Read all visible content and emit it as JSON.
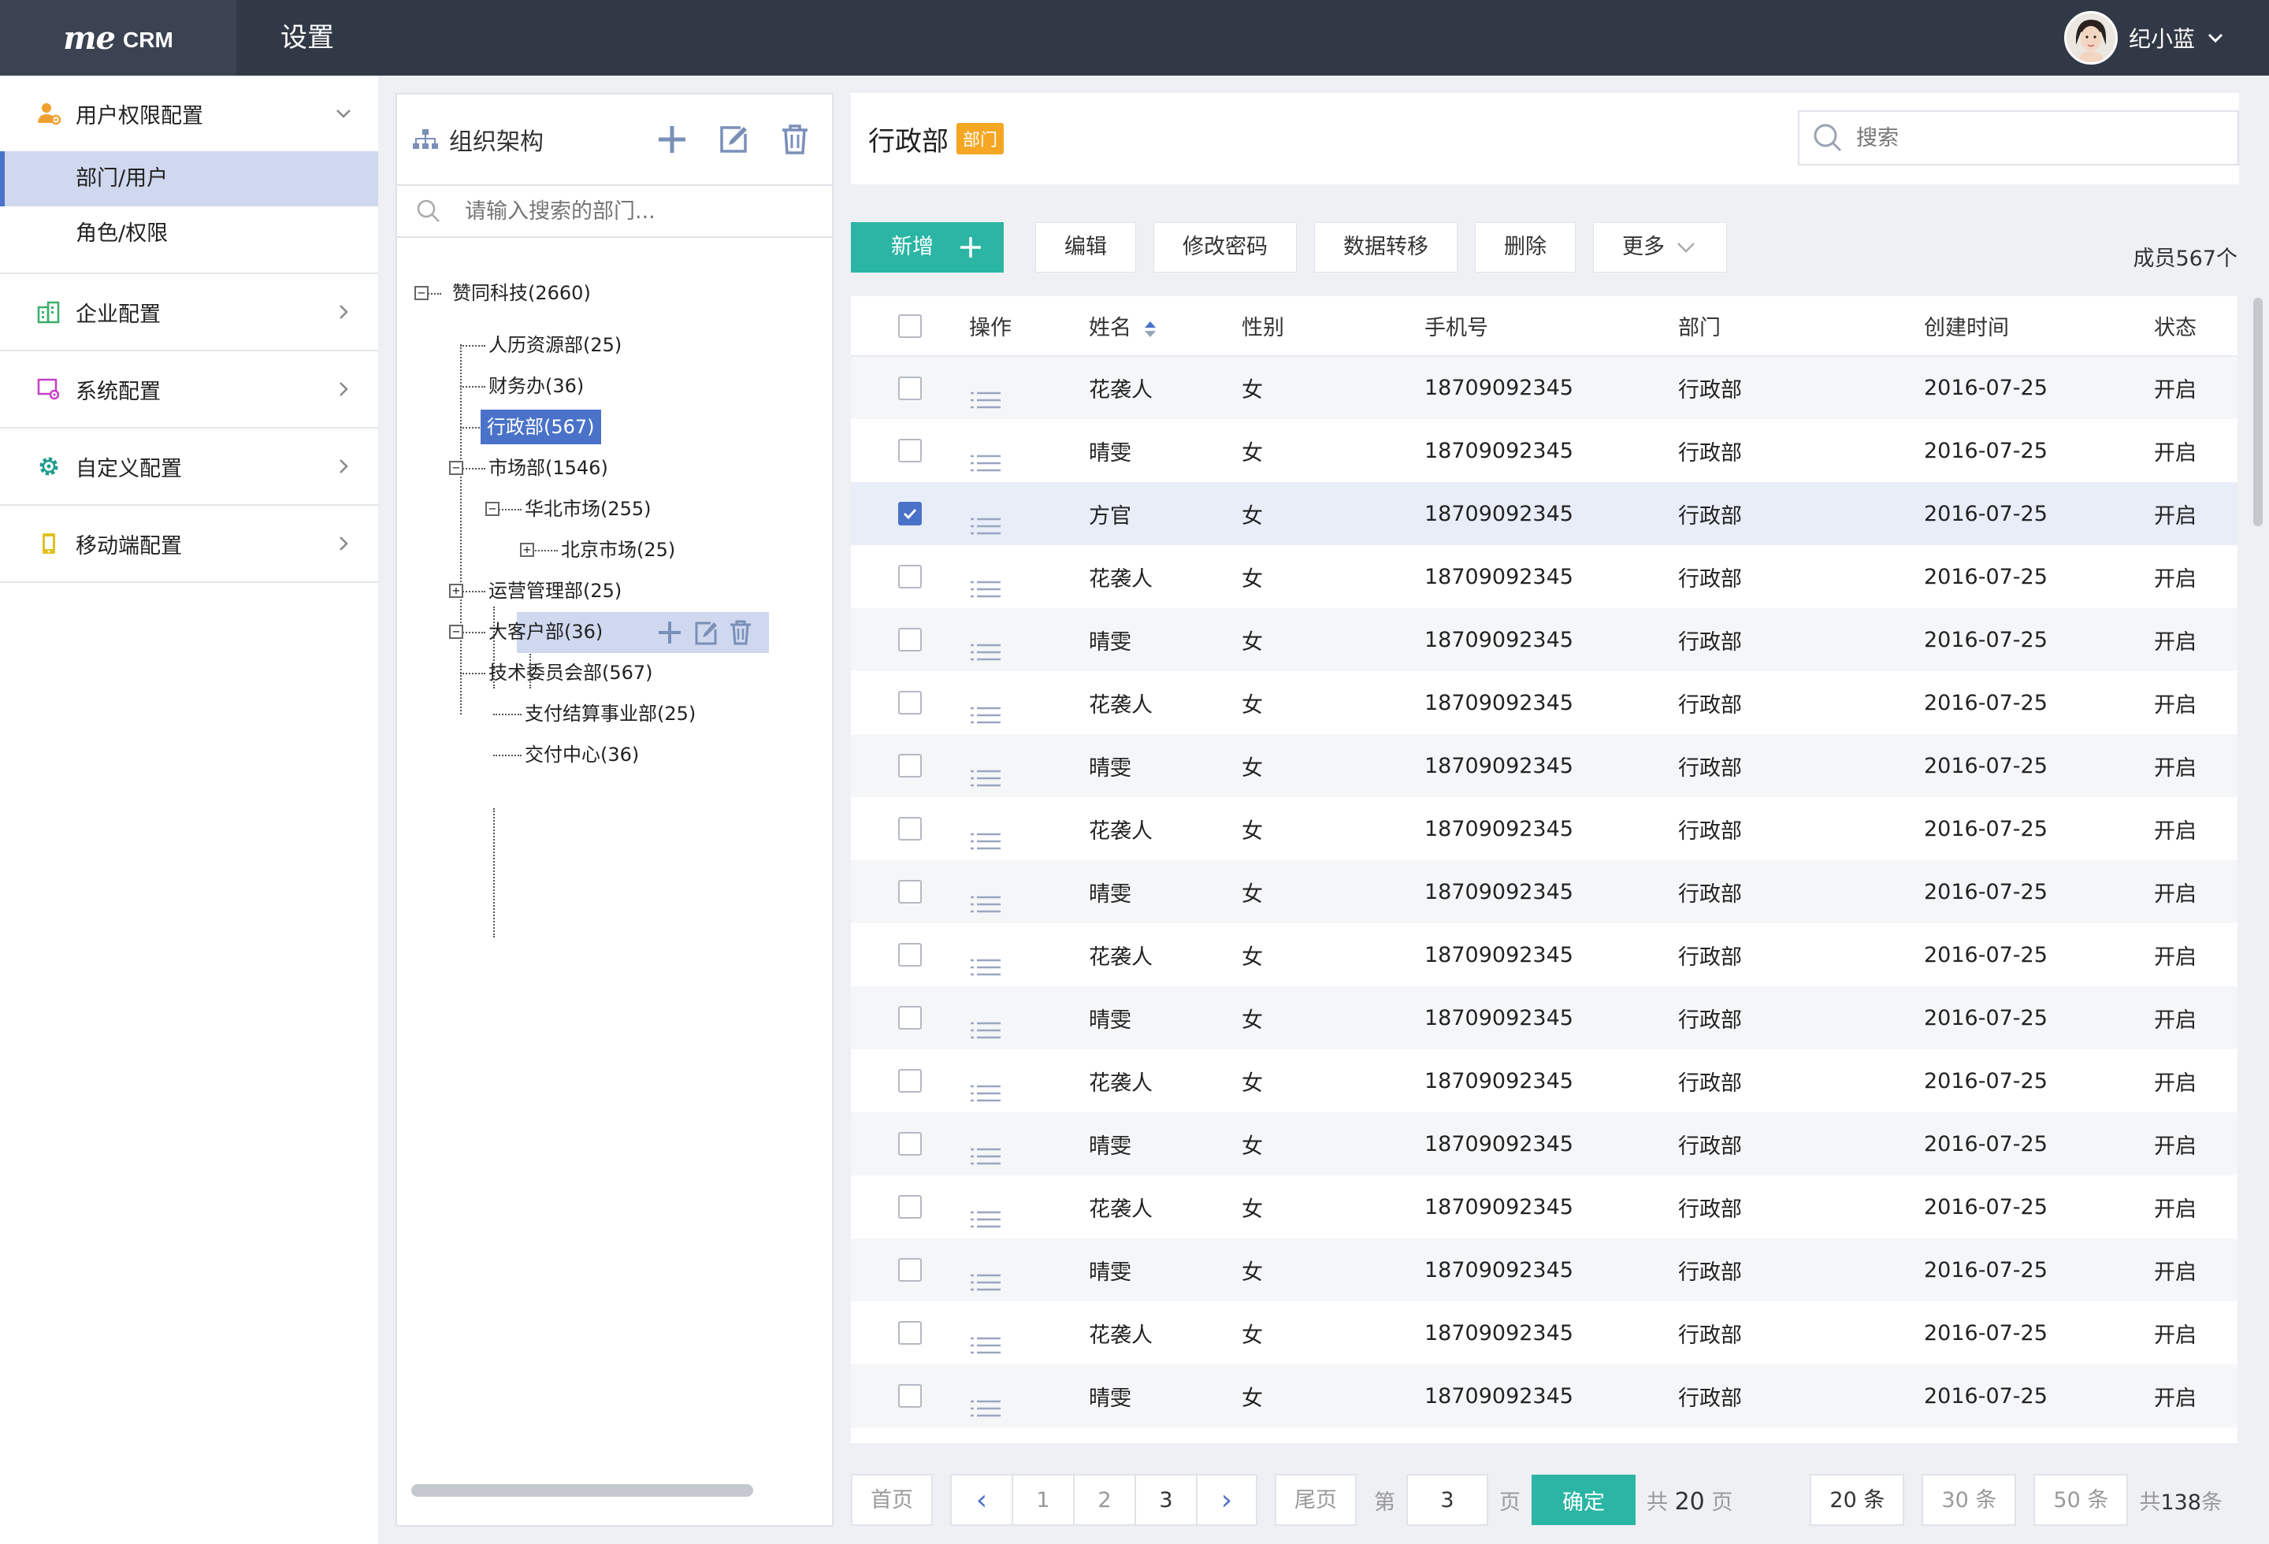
{
  "app": {
    "logo_me": "me",
    "logo_crm": "CRM",
    "title": "设置"
  },
  "user": {
    "name": "纪小蓝"
  },
  "sidebar": {
    "groups": [
      {
        "label": "用户权限配置",
        "icon": "user-permission-icon",
        "items": [
          {
            "label": "部门/用户",
            "active": true
          },
          {
            "label": "角色/权限"
          }
        ]
      },
      {
        "label": "企业配置",
        "icon": "enterprise-icon"
      },
      {
        "label": "系统配置",
        "icon": "system-icon"
      },
      {
        "label": "自定义配置",
        "icon": "gear-icon"
      },
      {
        "label": "移动端配置",
        "icon": "mobile-icon"
      }
    ]
  },
  "org": {
    "title": "组织架构",
    "search_placeholder": "请输入搜索的部门...",
    "tree": [
      {
        "label": "赞同科技(2660)",
        "toggle": "−"
      },
      {
        "label": "人历资源部(25)"
      },
      {
        "label": "财务办(36)"
      },
      {
        "label": "行政部(567)",
        "selected": true
      },
      {
        "label": "市场部(1546)",
        "toggle": "−"
      },
      {
        "label": "华北市场(255)",
        "toggle": "−",
        "hover": true
      },
      {
        "label": "北京市场(25)",
        "toggle": "+"
      },
      {
        "label": "运营管理部(25)",
        "toggle": "+"
      },
      {
        "label": "大客户部(36)"
      },
      {
        "label": "技术委员会部(567)",
        "toggle": "−"
      },
      {
        "label": "支付结算事业部(25)"
      },
      {
        "label": "交付中心(36)"
      }
    ]
  },
  "main": {
    "dept_name": "行政部",
    "dept_badge": "部门",
    "search_placeholder": "搜索",
    "member_count": "成员567个"
  },
  "toolbar": {
    "add": "新增",
    "edit": "编辑",
    "change_password": "修改密码",
    "data_transfer": "数据转移",
    "delete": "删除",
    "more": "更多"
  },
  "table": {
    "columns": [
      "操作",
      "姓名",
      "性别",
      "手机号",
      "部门",
      "创建时间",
      "状态"
    ],
    "rows": [
      {
        "name": "花袭人",
        "gender": "女",
        "phone": "18709092345",
        "dept": "行政部",
        "created": "2016-07-25",
        "status": "开启"
      },
      {
        "name": "晴雯",
        "gender": "女",
        "phone": "18709092345",
        "dept": "行政部",
        "created": "2016-07-25",
        "status": "开启"
      },
      {
        "name": "方官",
        "gender": "女",
        "phone": "18709092345",
        "dept": "行政部",
        "created": "2016-07-25",
        "status": "开启",
        "checked": true
      },
      {
        "name": "花袭人",
        "gender": "女",
        "phone": "18709092345",
        "dept": "行政部",
        "created": "2016-07-25",
        "status": "开启"
      },
      {
        "name": "晴雯",
        "gender": "女",
        "phone": "18709092345",
        "dept": "行政部",
        "created": "2016-07-25",
        "status": "开启"
      },
      {
        "name": "花袭人",
        "gender": "女",
        "phone": "18709092345",
        "dept": "行政部",
        "created": "2016-07-25",
        "status": "开启"
      },
      {
        "name": "晴雯",
        "gender": "女",
        "phone": "18709092345",
        "dept": "行政部",
        "created": "2016-07-25",
        "status": "开启"
      },
      {
        "name": "花袭人",
        "gender": "女",
        "phone": "18709092345",
        "dept": "行政部",
        "created": "2016-07-25",
        "status": "开启"
      },
      {
        "name": "晴雯",
        "gender": "女",
        "phone": "18709092345",
        "dept": "行政部",
        "created": "2016-07-25",
        "status": "开启"
      },
      {
        "name": "花袭人",
        "gender": "女",
        "phone": "18709092345",
        "dept": "行政部",
        "created": "2016-07-25",
        "status": "开启"
      },
      {
        "name": "晴雯",
        "gender": "女",
        "phone": "18709092345",
        "dept": "行政部",
        "created": "2016-07-25",
        "status": "开启"
      },
      {
        "name": "花袭人",
        "gender": "女",
        "phone": "18709092345",
        "dept": "行政部",
        "created": "2016-07-25",
        "status": "开启"
      },
      {
        "name": "晴雯",
        "gender": "女",
        "phone": "18709092345",
        "dept": "行政部",
        "created": "2016-07-25",
        "status": "开启"
      },
      {
        "name": "花袭人",
        "gender": "女",
        "phone": "18709092345",
        "dept": "行政部",
        "created": "2016-07-25",
        "status": "开启"
      },
      {
        "name": "晴雯",
        "gender": "女",
        "phone": "18709092345",
        "dept": "行政部",
        "created": "2016-07-25",
        "status": "开启"
      },
      {
        "name": "花袭人",
        "gender": "女",
        "phone": "18709092345",
        "dept": "行政部",
        "created": "2016-07-25",
        "status": "开启"
      },
      {
        "name": "晴雯",
        "gender": "女",
        "phone": "18709092345",
        "dept": "行政部",
        "created": "2016-07-25",
        "status": "开启"
      }
    ]
  },
  "pager": {
    "first": "首页",
    "prev": "‹",
    "pages": [
      "1",
      "2",
      "3"
    ],
    "current": "3",
    "next": "›",
    "last": "尾页",
    "goto_prefix": "第",
    "goto_value": "3",
    "goto_suffix": "页",
    "confirm": "确定",
    "total_pages_prefix": "共",
    "total_pages": "20",
    "total_pages_suffix": "页",
    "sizes": [
      "20 条",
      "30 条",
      "50 条"
    ],
    "active_size": "20 条",
    "total_items_prefix": "共",
    "total_items": "138",
    "total_items_suffix": "条"
  },
  "colors": {
    "topbar": "#323946",
    "accent": "#2bb5a4",
    "selected": "#4a72c8",
    "badge": "#f5a623"
  }
}
